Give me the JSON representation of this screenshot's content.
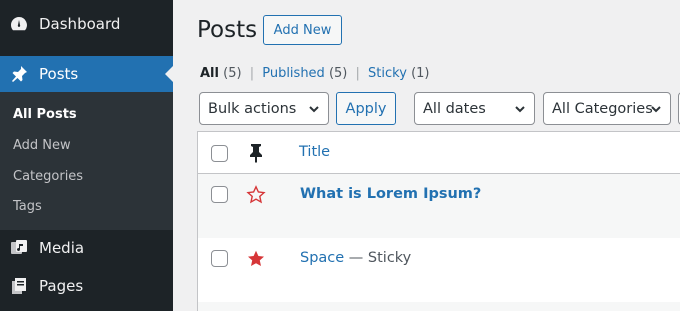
{
  "sidebar": {
    "menu": [
      {
        "label": "Dashboard",
        "icon": "dashboard-icon"
      },
      {
        "label": "Posts",
        "icon": "pin-icon",
        "active": true
      },
      {
        "label": "Media",
        "icon": "media-icon"
      },
      {
        "label": "Pages",
        "icon": "pages-icon"
      }
    ],
    "submenu": [
      {
        "label": "All Posts",
        "current": true
      },
      {
        "label": "Add New"
      },
      {
        "label": "Categories"
      },
      {
        "label": "Tags"
      }
    ]
  },
  "header": {
    "title": "Posts",
    "add_new": "Add New"
  },
  "filters": {
    "all_label": "All",
    "all_count": "(5)",
    "published_label": "Published",
    "published_count": "(5)",
    "sticky_label": "Sticky",
    "sticky_count": "(1)",
    "separator": "|"
  },
  "toolbar": {
    "bulk_actions": "Bulk actions",
    "apply": "Apply",
    "dates": "All dates",
    "categories": "All Categories"
  },
  "table": {
    "title_header": "Title",
    "rows": [
      {
        "title": "What is Lorem Ipsum?",
        "sticky": false,
        "state": ""
      },
      {
        "title": "Space",
        "sticky": true,
        "state": "Sticky",
        "dash": "—"
      }
    ]
  },
  "colors": {
    "accent": "#2271b1",
    "sidebar_bg": "#1d2327",
    "star": "#d63638"
  }
}
